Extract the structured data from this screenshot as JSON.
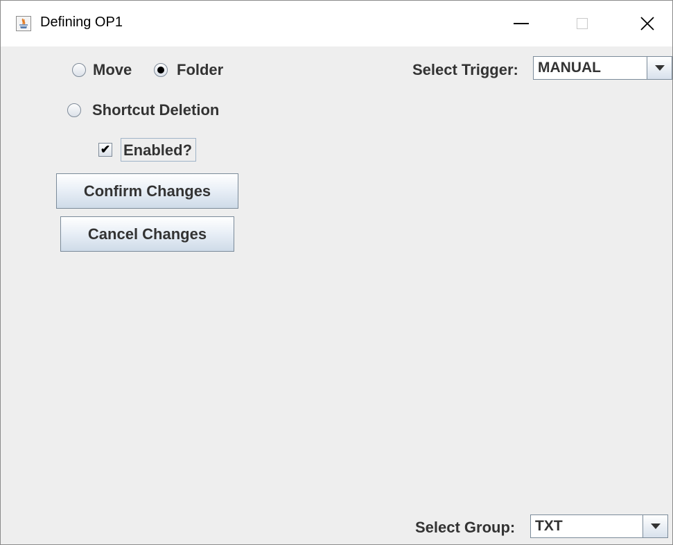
{
  "window": {
    "title": "Defining OP1",
    "icon": "java-cup-icon",
    "controls": {
      "minimize": "minimize-icon",
      "maximize": "maximize-icon",
      "close": "close-icon"
    }
  },
  "options": {
    "move": {
      "label": "Move",
      "selected": false
    },
    "folder": {
      "label": "Folder",
      "selected": true
    },
    "shortcut_deletion": {
      "label": "Shortcut Deletion",
      "selected": false
    }
  },
  "enabled": {
    "label": "Enabled?",
    "checked": true,
    "check_mark": "✔"
  },
  "buttons": {
    "confirm": "Confirm Changes",
    "cancel": "Cancel Changes"
  },
  "trigger": {
    "label": "Select Trigger:",
    "value": "MANUAL"
  },
  "group": {
    "label": "Select Group:",
    "value": "TXT"
  }
}
